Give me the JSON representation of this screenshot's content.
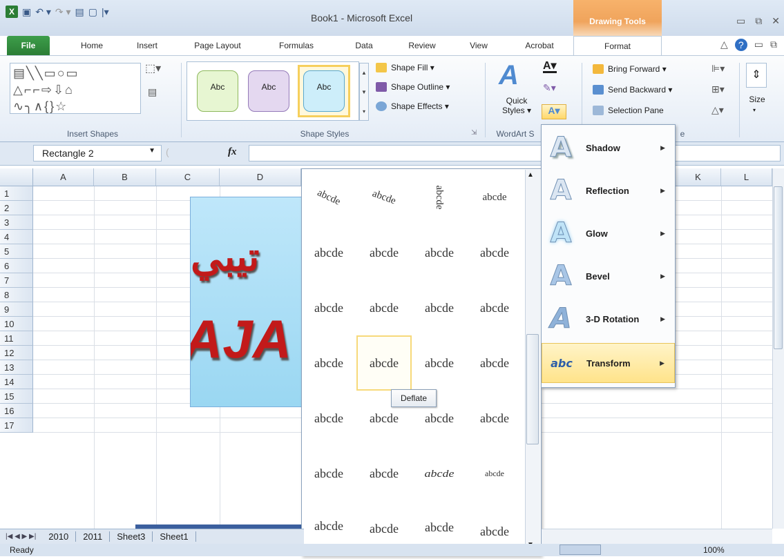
{
  "window": {
    "title": "Book1  -  Microsoft Excel",
    "contextual_tab_group": "Drawing Tools"
  },
  "tabs": [
    "File",
    "Home",
    "Insert",
    "Page Layout",
    "Formulas",
    "Data",
    "Review",
    "View",
    "Acrobat",
    "Format"
  ],
  "ribbon": {
    "groups": {
      "insert_shapes": "Insert Shapes",
      "shape_styles": "Shape Styles",
      "wordart_styles": "WordArt S",
      "arrange": "e",
      "size": "Size"
    },
    "shape_style_swatches": [
      "Abc",
      "Abc",
      "Abc"
    ],
    "shape_fill": "Shape Fill ▾",
    "shape_outline": "Shape Outline ▾",
    "shape_effects": "Shape Effects ▾",
    "quick_styles": "Quick Styles ▾",
    "bring_forward": "Bring Forward ▾",
    "send_backward": "Send Backward ▾",
    "selection_pane": "Selection Pane"
  },
  "formula_bar": {
    "name_box": "Rectangle 2",
    "fx": "fx",
    "value": ""
  },
  "columns": [
    "A",
    "B",
    "C",
    "D",
    "K",
    "L"
  ],
  "rows": [
    "1",
    "2",
    "3",
    "4",
    "5",
    "6",
    "7",
    "8",
    "9",
    "10",
    "11",
    "12",
    "13",
    "14",
    "15",
    "16",
    "17"
  ],
  "shape": {
    "arabic_text": "تيبي",
    "latin_text": "AJA"
  },
  "transform_gallery": {
    "cells": [
      [
        "abcde",
        "abcde",
        "abcde",
        "abcde"
      ],
      [
        "abcde",
        "abcde",
        "abcde",
        "abcde"
      ],
      [
        "abcde",
        "abcde",
        "abcde",
        "abcde"
      ],
      [
        "abcde",
        "abcde",
        "abcde",
        "abcde"
      ],
      [
        "abcde",
        "abcde",
        "abcde",
        "abcde"
      ],
      [
        "abcde",
        "abcde",
        "abcde",
        "abcde"
      ],
      [
        "abcde",
        "abcde",
        "abcde",
        "abcde"
      ]
    ],
    "stacked_text": "abcde\nabc\nabcde",
    "tooltip": "Deflate"
  },
  "text_effects_menu": [
    {
      "label": "Shadow",
      "icon": "text-shadow-icon"
    },
    {
      "label": "Reflection",
      "icon": "text-reflection-icon"
    },
    {
      "label": "Glow",
      "icon": "text-glow-icon"
    },
    {
      "label": "Bevel",
      "icon": "text-bevel-icon"
    },
    {
      "label": "3-D Rotation",
      "icon": "text-3d-rotation-icon"
    },
    {
      "label": "Transform",
      "icon": "text-transform-icon"
    }
  ],
  "sheet_tabs": [
    "2010",
    "2011",
    "Sheet3",
    "Sheet1"
  ],
  "status": {
    "ready": "Ready",
    "zoom": "100%"
  },
  "colors": {
    "accent_file": "#2b7d35",
    "drawing_tools": "#f0a45c",
    "wordart_red": "#c21a1a",
    "highlight": "#ffe38a"
  }
}
